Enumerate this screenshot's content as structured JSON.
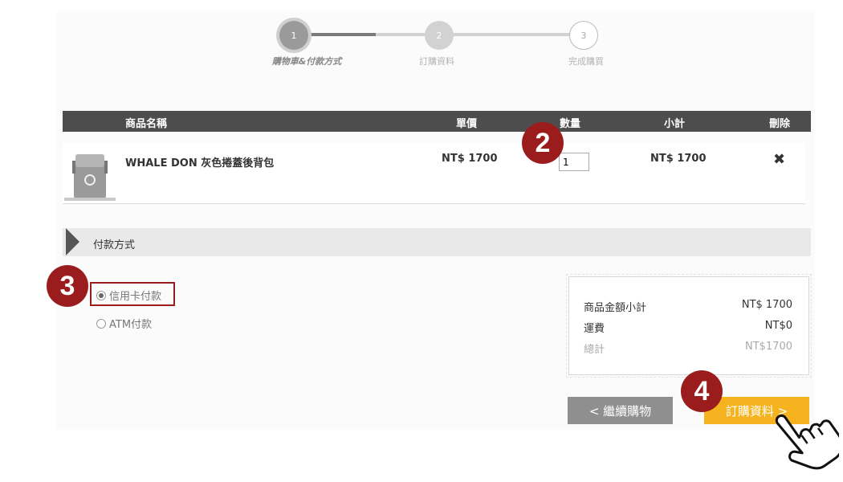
{
  "stepper": {
    "steps": [
      {
        "num": "1",
        "label": "購物車&付款方式"
      },
      {
        "num": "2",
        "label": "訂購資料"
      },
      {
        "num": "3",
        "label": "完成購買"
      }
    ]
  },
  "table": {
    "headers": {
      "name": "商品名稱",
      "price": "單價",
      "qty": "數量",
      "subtotal": "小計",
      "delete": "刪除"
    },
    "items": [
      {
        "name": "WHALE DON 灰色捲蓋後背包",
        "price": "NT$ 1700",
        "qty": "1",
        "subtotal": "NT$ 1700",
        "delete_icon": "✖"
      }
    ]
  },
  "payment": {
    "title": "付款方式",
    "options": [
      {
        "label": "信用卡付款",
        "checked": true
      },
      {
        "label": "ATM付款",
        "checked": false
      }
    ]
  },
  "summary": {
    "rows": [
      {
        "label": "商品金額小計",
        "value": "NT$ 1700"
      },
      {
        "label": "運費",
        "value": "NT$0"
      },
      {
        "label": "總計",
        "value": "NT$1700"
      }
    ]
  },
  "buttons": {
    "back": "< 繼續購物",
    "next": "訂購資料 >"
  },
  "markers": {
    "m2": "2",
    "m3": "3",
    "m4": "4"
  },
  "colors": {
    "marker": "#9b1c1c",
    "next_button": "#f5b41f",
    "back_button": "#8f8f8f",
    "header_bar": "#4d4d4d"
  }
}
